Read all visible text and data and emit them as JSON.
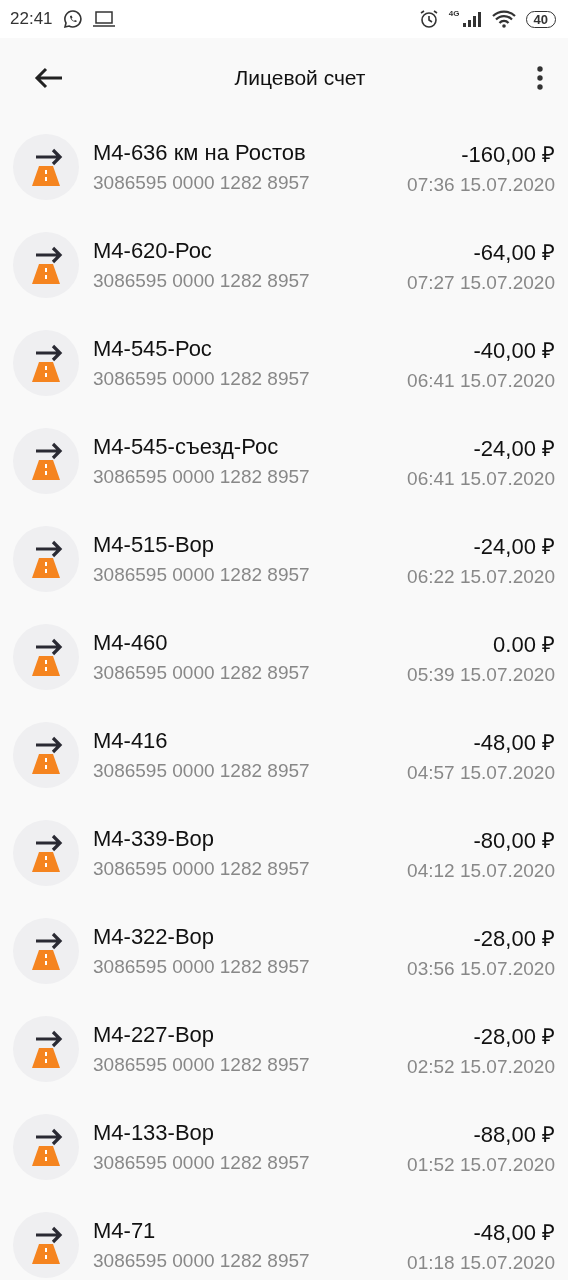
{
  "status_bar": {
    "time": "22:41",
    "network": "4G",
    "battery": "40"
  },
  "header": {
    "title": "Лицевой счет"
  },
  "transactions": [
    {
      "title": "М4-636 км на Ростов",
      "card": "3086595 0000 1282 8957",
      "amount": "-160,00 ₽",
      "datetime": "07:36 15.07.2020"
    },
    {
      "title": "М4-620-Рос",
      "card": "3086595 0000 1282 8957",
      "amount": "-64,00 ₽",
      "datetime": "07:27 15.07.2020"
    },
    {
      "title": "М4-545-Рос",
      "card": "3086595 0000 1282 8957",
      "amount": "-40,00 ₽",
      "datetime": "06:41 15.07.2020"
    },
    {
      "title": "М4-545-съезд-Рос",
      "card": "3086595 0000 1282 8957",
      "amount": "-24,00 ₽",
      "datetime": "06:41 15.07.2020"
    },
    {
      "title": "М4-515-Вор",
      "card": "3086595 0000 1282 8957",
      "amount": "-24,00 ₽",
      "datetime": "06:22 15.07.2020"
    },
    {
      "title": "М4-460",
      "card": "3086595 0000 1282 8957",
      "amount": "0.00 ₽",
      "datetime": "05:39 15.07.2020"
    },
    {
      "title": "М4-416",
      "card": "3086595 0000 1282 8957",
      "amount": "-48,00 ₽",
      "datetime": "04:57 15.07.2020"
    },
    {
      "title": "М4-339-Вор",
      "card": "3086595 0000 1282 8957",
      "amount": "-80,00 ₽",
      "datetime": "04:12 15.07.2020"
    },
    {
      "title": "М4-322-Вор",
      "card": "3086595 0000 1282 8957",
      "amount": "-28,00 ₽",
      "datetime": "03:56 15.07.2020"
    },
    {
      "title": "М4-227-Вор",
      "card": "3086595 0000 1282 8957",
      "amount": "-28,00 ₽",
      "datetime": "02:52 15.07.2020"
    },
    {
      "title": "М4-133-Вор",
      "card": "3086595 0000 1282 8957",
      "amount": "-88,00 ₽",
      "datetime": "01:52 15.07.2020"
    },
    {
      "title": "М4-71",
      "card": "3086595 0000 1282 8957",
      "amount": "-48,00 ₽",
      "datetime": "01:18 15.07.2020"
    }
  ]
}
